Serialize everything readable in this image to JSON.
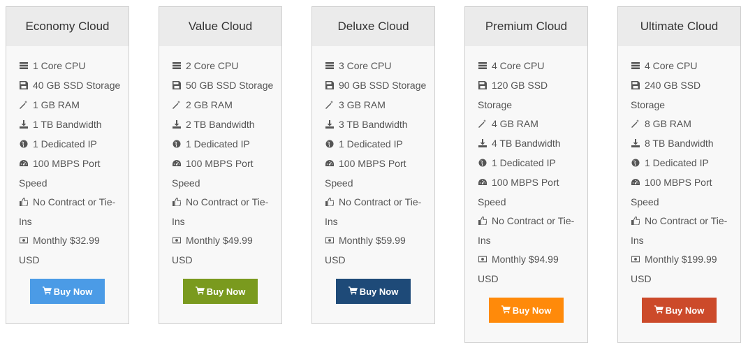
{
  "plans": [
    {
      "name": "Economy Cloud",
      "button_label": "Buy Now",
      "button_color": "#4b9be6",
      "features": [
        {
          "icon": "server-icon",
          "text": "1 Core CPU"
        },
        {
          "icon": "floppy-disk-icon",
          "text": "40 GB SSD Storage"
        },
        {
          "icon": "magic-wand-icon",
          "text": "1 GB RAM"
        },
        {
          "icon": "download-icon",
          "text": "1 TB Bandwidth"
        },
        {
          "icon": "globe-icon",
          "text": "1 Dedicated IP"
        },
        {
          "icon": "dashboard-icon",
          "text": "100 MBPS Port Speed"
        },
        {
          "icon": "thumbs-up-icon",
          "text": "No Contract or Tie-Ins"
        },
        {
          "icon": "money-icon",
          "text": "Monthly $32.99 USD"
        }
      ]
    },
    {
      "name": "Value Cloud",
      "button_label": "Buy Now",
      "button_color": "#7a9a1e",
      "features": [
        {
          "icon": "server-icon",
          "text": "2 Core CPU"
        },
        {
          "icon": "floppy-disk-icon",
          "text": "50 GB SSD Storage"
        },
        {
          "icon": "magic-wand-icon",
          "text": "2 GB RAM"
        },
        {
          "icon": "download-icon",
          "text": "2 TB Bandwidth"
        },
        {
          "icon": "globe-icon",
          "text": "1 Dedicated IP"
        },
        {
          "icon": "dashboard-icon",
          "text": "100 MBPS Port Speed"
        },
        {
          "icon": "thumbs-up-icon",
          "text": "No Contract or Tie-Ins"
        },
        {
          "icon": "money-icon",
          "text": "Monthly $49.99 USD"
        }
      ]
    },
    {
      "name": "Deluxe Cloud",
      "button_label": "Buy Now",
      "button_color": "#1e4a78",
      "features": [
        {
          "icon": "server-icon",
          "text": "3 Core CPU"
        },
        {
          "icon": "floppy-disk-icon",
          "text": "90 GB SSD Storage"
        },
        {
          "icon": "magic-wand-icon",
          "text": "3 GB RAM"
        },
        {
          "icon": "download-icon",
          "text": "3 TB Bandwidth"
        },
        {
          "icon": "globe-icon",
          "text": "1 Dedicated IP"
        },
        {
          "icon": "dashboard-icon",
          "text": "100 MBPS Port Speed"
        },
        {
          "icon": "thumbs-up-icon",
          "text": "No Contract or Tie-Ins"
        },
        {
          "icon": "money-icon",
          "text": "Monthly $59.99 USD"
        }
      ]
    },
    {
      "name": "Premium Cloud",
      "button_label": "Buy Now",
      "button_color": "#ff8a0a",
      "features": [
        {
          "icon": "server-icon",
          "text": "4 Core CPU"
        },
        {
          "icon": "floppy-disk-icon",
          "text": "120 GB SSD Storage"
        },
        {
          "icon": "magic-wand-icon",
          "text": "4 GB RAM"
        },
        {
          "icon": "download-icon",
          "text": "4 TB Bandwidth"
        },
        {
          "icon": "globe-icon",
          "text": "1 Dedicated IP"
        },
        {
          "icon": "dashboard-icon",
          "text": "100 MBPS Port Speed"
        },
        {
          "icon": "thumbs-up-icon",
          "text": "No Contract or Tie-Ins"
        },
        {
          "icon": "money-icon",
          "text": "Monthly $94.99 USD"
        }
      ]
    },
    {
      "name": "Ultimate Cloud",
      "button_label": "Buy Now",
      "button_color": "#cc4a2a",
      "features": [
        {
          "icon": "server-icon",
          "text": "4 Core CPU"
        },
        {
          "icon": "floppy-disk-icon",
          "text": "240 GB SSD Storage"
        },
        {
          "icon": "magic-wand-icon",
          "text": "8 GB RAM"
        },
        {
          "icon": "download-icon",
          "text": "8 TB Bandwidth"
        },
        {
          "icon": "globe-icon",
          "text": "1 Dedicated IP"
        },
        {
          "icon": "dashboard-icon",
          "text": "100 MBPS Port Speed"
        },
        {
          "icon": "thumbs-up-icon",
          "text": "No Contract or Tie-Ins"
        },
        {
          "icon": "money-icon",
          "text": "Monthly $199.99 USD"
        }
      ]
    }
  ]
}
